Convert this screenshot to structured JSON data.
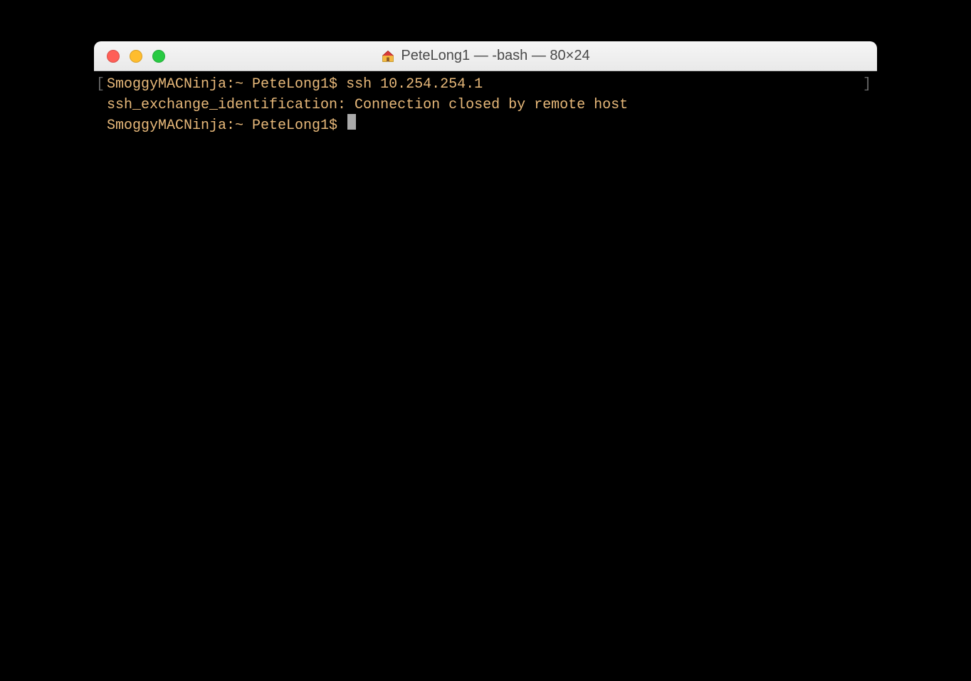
{
  "window": {
    "title": "PeteLong1 — -bash — 80×24"
  },
  "terminal": {
    "bracket_left": "[",
    "bracket_right": "]",
    "lines": [
      {
        "prompt": "SmoggyMACNinja:~ PeteLong1$ ",
        "command": "ssh 10.254.254.1"
      },
      {
        "output": "ssh_exchange_identification: Connection closed by remote host"
      },
      {
        "prompt": "SmoggyMACNinja:~ PeteLong1$ ",
        "cursor": true
      }
    ]
  }
}
